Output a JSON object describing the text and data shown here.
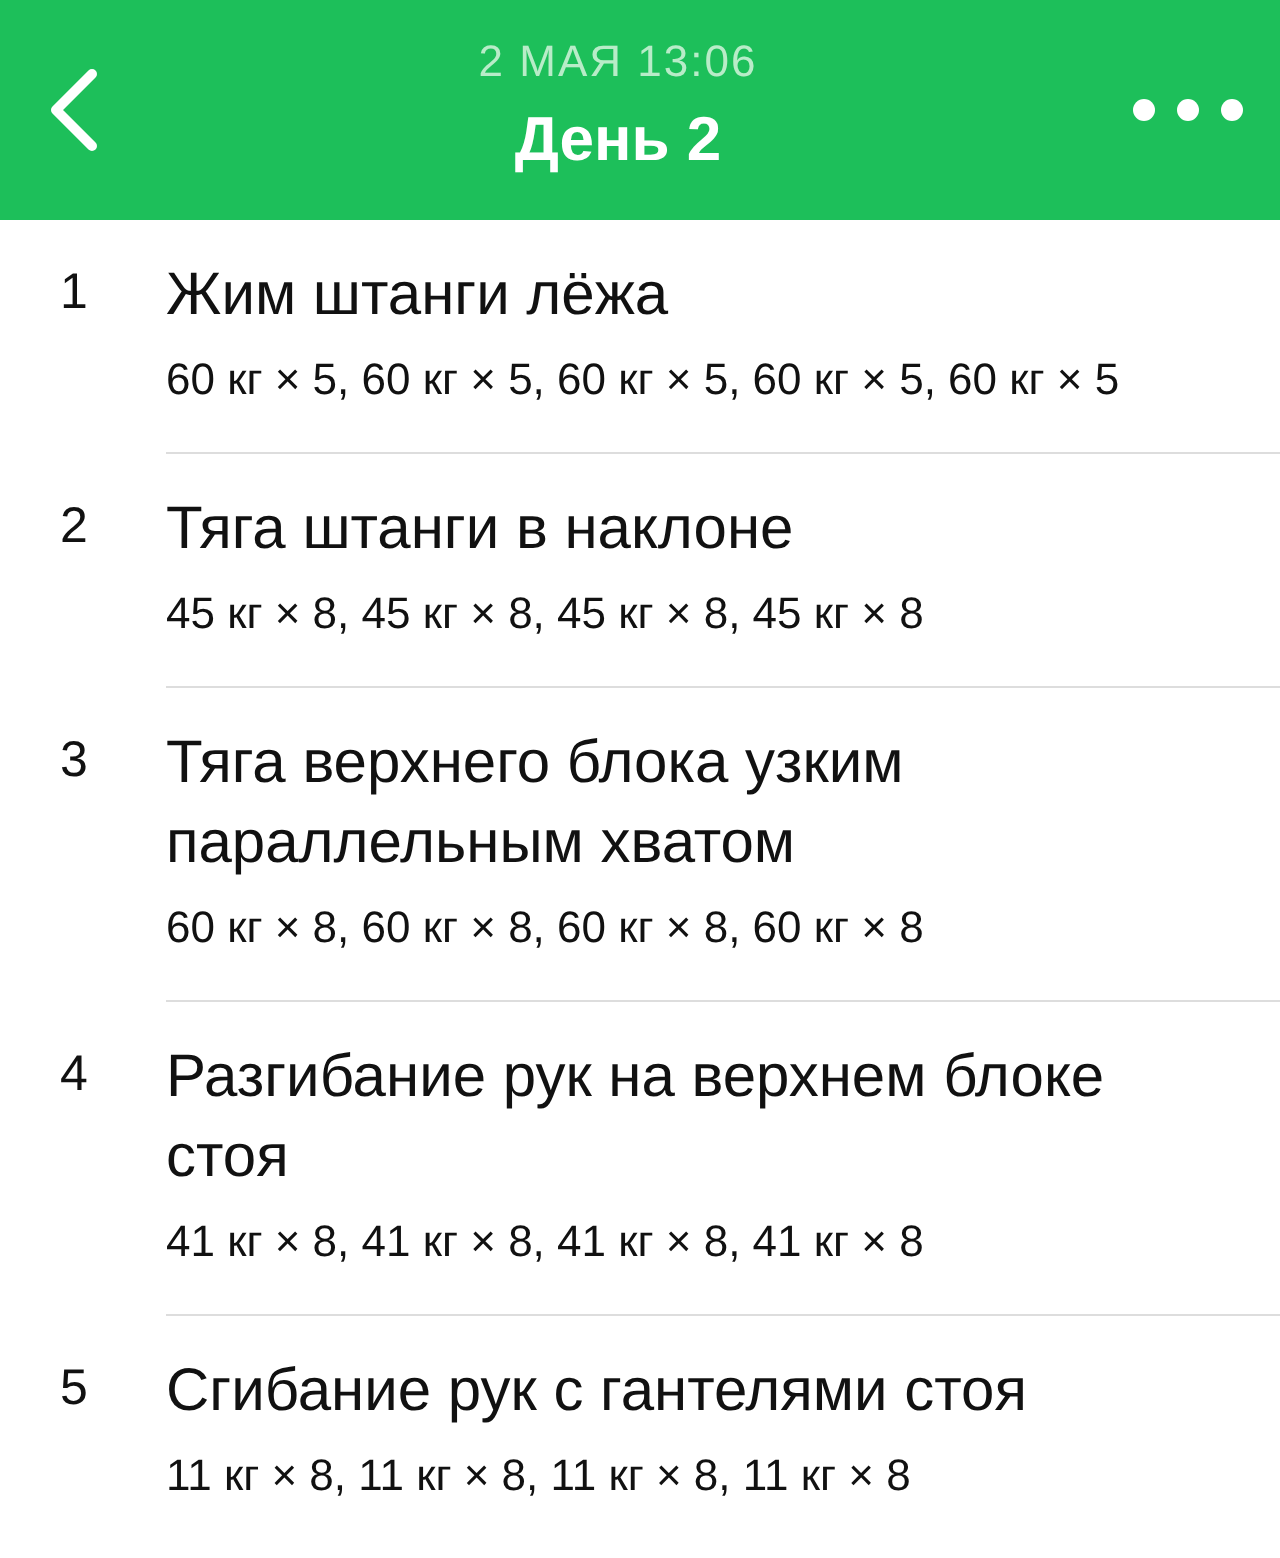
{
  "header": {
    "subtitle": "2 МАЯ 13:06",
    "title": "День 2"
  },
  "exercises": [
    {
      "number": "1",
      "name": "Жим штанги лёжа",
      "sets": "60 кг × 5, 60 кг × 5, 60 кг × 5, 60 кг × 5, 60 кг × 5"
    },
    {
      "number": "2",
      "name": "Тяга штанги в наклоне",
      "sets": "45 кг × 8, 45 кг × 8, 45 кг × 8, 45 кг × 8"
    },
    {
      "number": "3",
      "name": "Тяга верхнего блока узким параллельным хватом",
      "sets": "60 кг × 8, 60 кг × 8, 60 кг × 8, 60 кг × 8"
    },
    {
      "number": "4",
      "name": "Разгибание рук на верхнем блоке стоя",
      "sets": "41 кг × 8, 41 кг × 8, 41 кг × 8, 41 кг × 8"
    },
    {
      "number": "5",
      "name": "Сгибание рук с гантелями стоя",
      "sets": "11 кг × 8, 11 кг × 8, 11 кг × 8, 11 кг × 8"
    }
  ]
}
